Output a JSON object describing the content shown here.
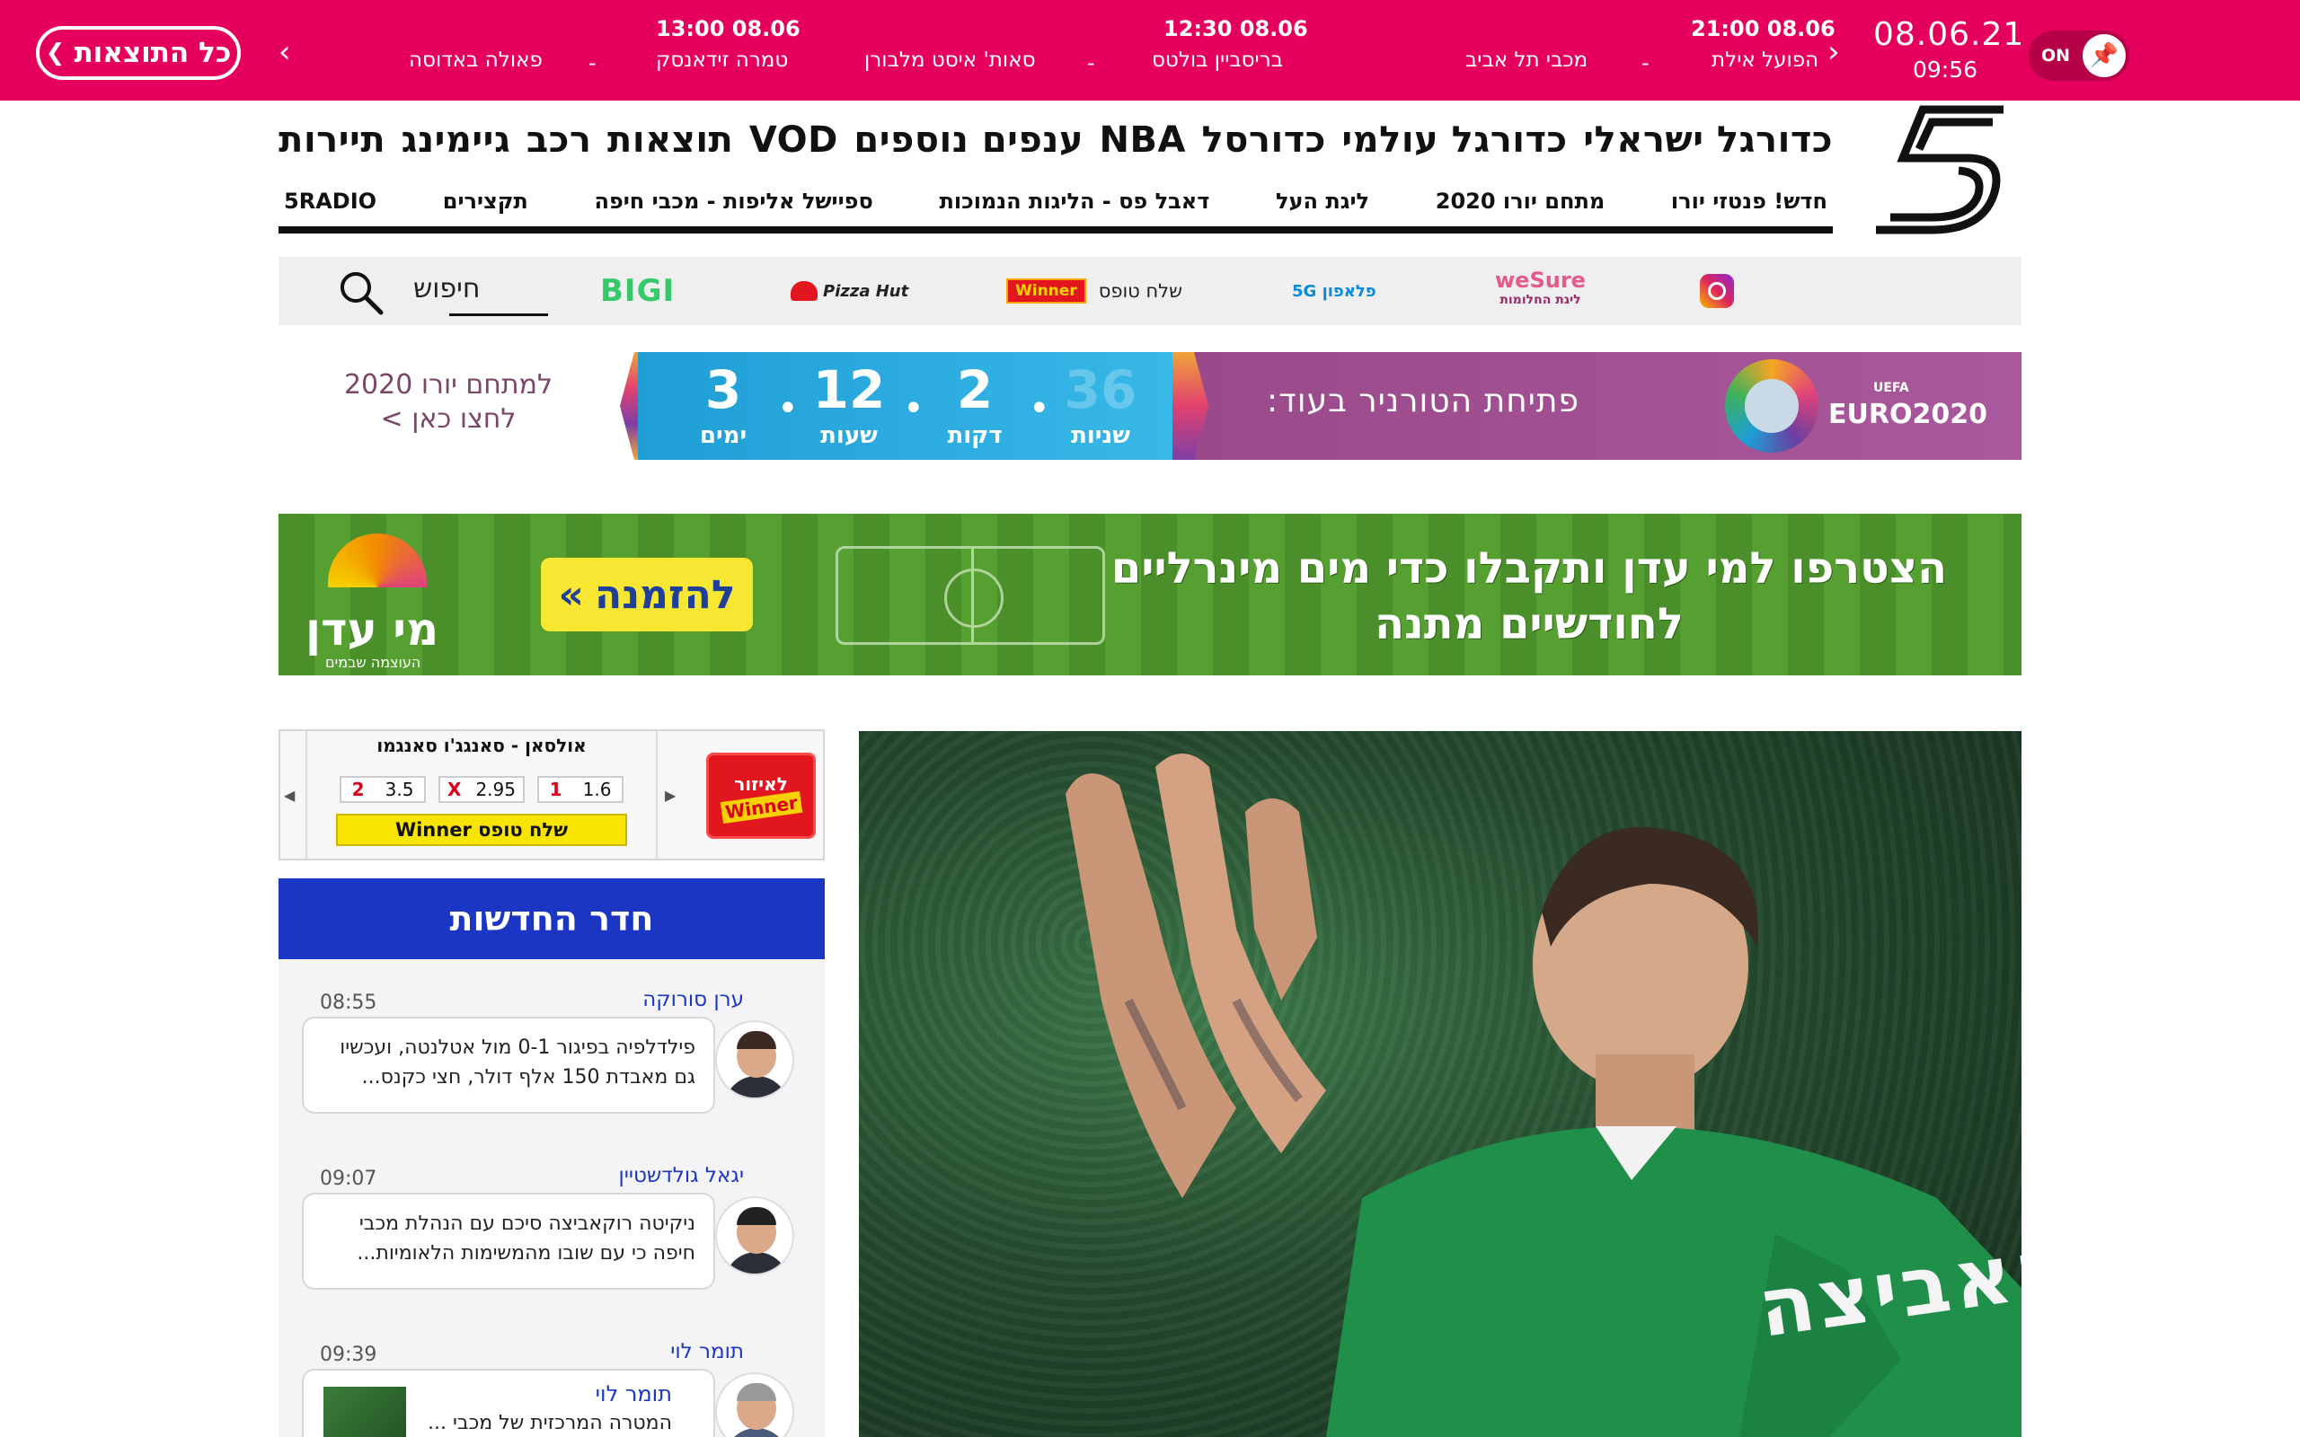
{
  "topbar": {
    "all_results_label": "כל התוצאות",
    "date": "08.06.21",
    "clock": "09:56",
    "toggle_label": "ON",
    "matches": [
      {
        "time": "08.06 21:00",
        "home": "הפועל אילת",
        "away": "מכבי תל אביב"
      },
      {
        "time": "08.06 12:30",
        "home": "בריסביין בולטס",
        "away": "סאות' איסט מלבורן"
      },
      {
        "time": "08.06 13:00",
        "home": "טמרה זידאנסק",
        "away": "פאולה באדוסה"
      }
    ]
  },
  "main_nav": [
    "כדורגל ישראלי",
    "כדורגל עולמי",
    "כדורסל",
    "NBA",
    "ענפים נוספים",
    "VOD",
    "תוצאות",
    "רכב",
    "גיימינג",
    "תיירות"
  ],
  "sub_nav": [
    "חדש! פנטזי יורו",
    "מתחם יורו 2020",
    "ליגת העל",
    "דאבל פס - הליגות הנמוכות",
    "ספיישל אליפות - מכבי חיפה",
    "תקצירים",
    "5RADIO"
  ],
  "sponsors": {
    "instagram": "instagram-icon",
    "wesure_top": "weSure",
    "wesure_bottom": "ליגת החלומות",
    "pelephone": "פלאפון 5G",
    "winner_logo": "Winner",
    "winner_text": "שלח טופס",
    "pizzahut": "Pizza Hut",
    "bigi": "BIGI",
    "search_label": "חיפוש"
  },
  "euro_banner": {
    "left_line1": "למתחם יורו 2020",
    "left_line2": "לחצו כאן >",
    "countdown": [
      {
        "value": "3",
        "label": "ימים"
      },
      {
        "value": "12",
        "label": "שעות"
      },
      {
        "value": "2",
        "label": "דקות"
      },
      {
        "value": "36",
        "label": "שניות"
      }
    ],
    "tagline": "פתיחת הטורניר בעוד:",
    "logo_text": "EURO2020",
    "uefa": "UEFA"
  },
  "water_ad": {
    "line1": "הצטרפו למי עדן ותקבלו כדי מים מינרליים",
    "line2": "לחודשיים מתנה",
    "button": "להזמנה",
    "brand": "מי עדן",
    "brand_sub": "העוצמה שבמים"
  },
  "bet_widget": {
    "match": "אולסאן - סאנגג'ו סאנגמו",
    "odds": [
      {
        "key": "1",
        "value": "1.6"
      },
      {
        "key": "X",
        "value": "2.95"
      },
      {
        "key": "2",
        "value": "3.5"
      }
    ],
    "send": "שלח טופס Winner",
    "logo_top": "לאיזור",
    "logo_brand": "Winner"
  },
  "newsroom": {
    "title": "חדר החדשות",
    "items": [
      {
        "author": "ערן סורוקה",
        "time": "08:55",
        "text": "פילדלפיה בפיגור 0-1 מול אטלנטה, ועכשיו גם מאבדת 150 אלף דולר, חצי כקנס..."
      },
      {
        "author": "יגאל גולדשטיין",
        "time": "09:07",
        "text": "ניקיטה רוקאביצה סיכם עם הנהלת מכבי חיפה כי עם שובו מהמשימות הלאומיות..."
      },
      {
        "author": "תומר לוי",
        "time": "09:39",
        "inner_author": "תומר לוי",
        "inner_text": "המטרה המרכזית של מכבי ..."
      }
    ]
  },
  "hero": {
    "jersey_text": "רוקאביצה",
    "alt": "hero-photo"
  }
}
